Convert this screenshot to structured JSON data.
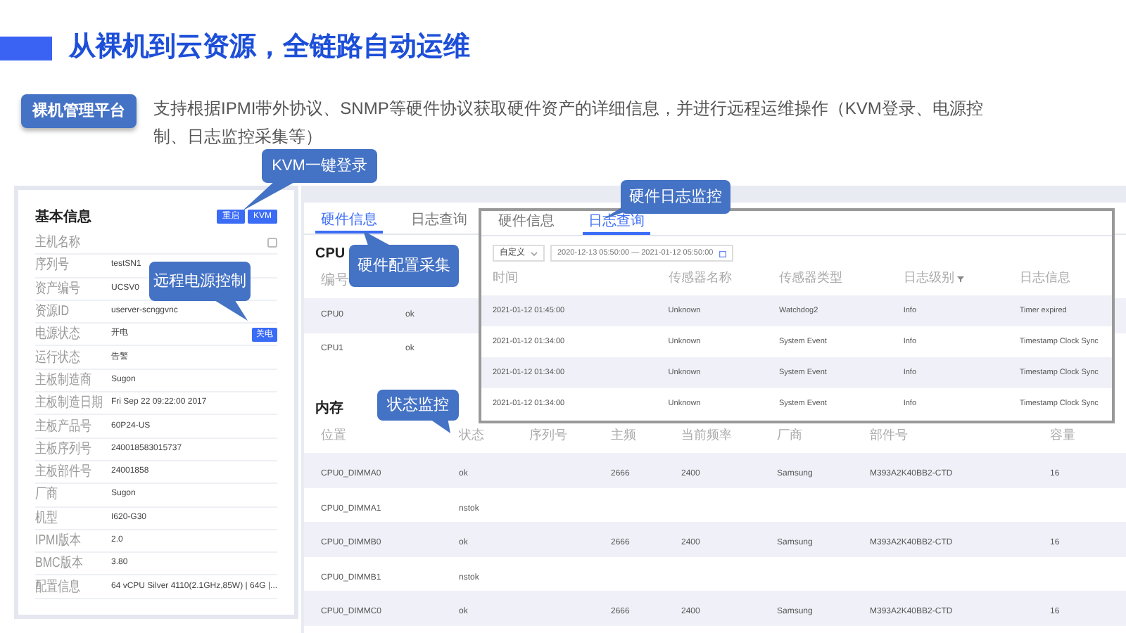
{
  "title": "从裸机到云资源，全链路自动运维",
  "badge": "裸机管理平台",
  "description": "支持根据IPMI带外协议、SNMP等硬件协议获取硬件资产的详细信息，并进行远程运维操作（KVM登录、电源控制、日志监控采集等）",
  "basic_info": {
    "title": "基本信息",
    "buttons": [
      "重启",
      "KVM"
    ],
    "rows": [
      {
        "label": "主机名称",
        "value": "",
        "kind": "copy"
      },
      {
        "label": "序列号",
        "value": "testSN1"
      },
      {
        "label": "资产编号",
        "value": "UCSV0"
      },
      {
        "label": "资源ID",
        "value": "userver-scnggvnc"
      },
      {
        "label": "电源状态",
        "value": "开电",
        "kind": "action",
        "action": "关电"
      },
      {
        "label": "运行状态",
        "value": "告警"
      },
      {
        "label": "主板制造商",
        "value": "Sugon"
      },
      {
        "label": "主板制造日期",
        "value": "Fri Sep 22 09:22:00 2017"
      },
      {
        "label": "主板产品号",
        "value": "60P24-US"
      },
      {
        "label": "主板序列号",
        "value": "240018583015737"
      },
      {
        "label": "主板部件号",
        "value": "24001858"
      },
      {
        "label": "厂商",
        "value": "Sugon"
      },
      {
        "label": "机型",
        "value": "I620-G30"
      },
      {
        "label": "IPMI版本",
        "value": "2.0"
      },
      {
        "label": "BMC版本",
        "value": "3.80"
      },
      {
        "label": "配置信息",
        "value": "64 vCPU Silver 4110(2.1GHz,85W) | 64G |..."
      }
    ]
  },
  "hardware_panel": {
    "tabs": [
      {
        "label": "硬件信息",
        "selected": true
      },
      {
        "label": "日志查询",
        "selected": false
      }
    ],
    "cpu": {
      "title": "CPU",
      "columns": [
        "编号"
      ],
      "rows": [
        [
          "CPU0",
          "ok"
        ],
        [
          "CPU1",
          "ok"
        ]
      ]
    },
    "memory": {
      "title": "内存",
      "columns": [
        "位置",
        "状态",
        "序列号",
        "主频",
        "当前频率",
        "厂商",
        "部件号",
        "容量"
      ],
      "rows": [
        [
          "CPU0_DIMMA0",
          "ok",
          "",
          "2666",
          "2400",
          "Samsung",
          "M393A2K40BB2-CTD",
          "16"
        ],
        [
          "CPU0_DIMMA1",
          "nstok",
          "",
          "",
          "",
          "",
          "",
          ""
        ],
        [
          "CPU0_DIMMB0",
          "ok",
          "",
          "2666",
          "2400",
          "Samsung",
          "M393A2K40BB2-CTD",
          "16"
        ],
        [
          "CPU0_DIMMB1",
          "nstok",
          "",
          "",
          "",
          "",
          "",
          ""
        ],
        [
          "CPU0_DIMMC0",
          "ok",
          "",
          "2666",
          "2400",
          "Samsung",
          "M393A2K40BB2-CTD",
          "16"
        ]
      ]
    }
  },
  "log_panel": {
    "tabs": [
      {
        "label": "硬件信息",
        "selected": false
      },
      {
        "label": "日志查询",
        "selected": true
      }
    ],
    "range_select": "自定义",
    "date_range": "2020-12-13 05:50:00 — 2021-01-12 05:50:00",
    "columns": [
      "时间",
      "传感器名称",
      "传感器类型",
      "日志级别",
      "日志信息"
    ],
    "rows": [
      [
        "2021-01-12 01:45:00",
        "Unknown",
        "Watchdog2",
        "Info",
        "Timer expired"
      ],
      [
        "2021-01-12 01:34:00",
        "Unknown",
        "System Event",
        "Info",
        "Timestamp Clock Sync"
      ],
      [
        "2021-01-12 01:34:00",
        "Unknown",
        "System Event",
        "Info",
        "Timestamp Clock Sync"
      ],
      [
        "2021-01-12 01:34:00",
        "Unknown",
        "System Event",
        "Info",
        "Timestamp Clock Sync"
      ]
    ]
  },
  "callouts": [
    {
      "text": "KVM一键登录"
    },
    {
      "text": "远程电源控制"
    },
    {
      "text": "硬件配置采集"
    },
    {
      "text": "状态监控"
    },
    {
      "text": "硬件日志监控"
    }
  ]
}
